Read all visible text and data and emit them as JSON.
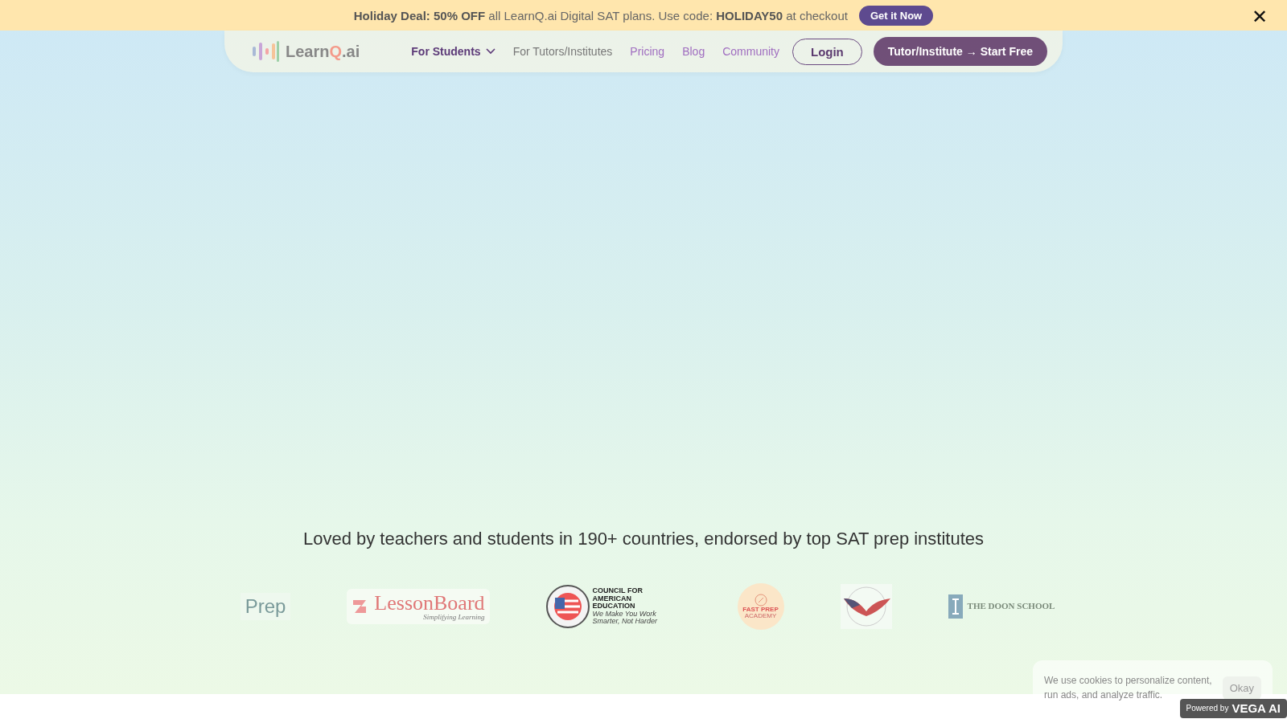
{
  "announcement": {
    "text": "**Holiday Deal: 50% OFF** all LearnQ.ai Digital SAT plans. Use code: **HOLIDAY50** at checkout",
    "button": "Get it Now",
    "close": "✕"
  },
  "navbar": {
    "logo": {
      "first": "Learn",
      "accent": "Q",
      "last": ".ai"
    },
    "items": [
      {
        "label": "For Students",
        "kind": "dropdown",
        "selected": true
      },
      {
        "label": "For Tutors/Institutes",
        "kind": "link",
        "selected": false
      },
      {
        "label": "Pricing",
        "kind": "link",
        "selected": false
      },
      {
        "label": "Blog",
        "kind": "link",
        "selected": false
      },
      {
        "label": "Community",
        "kind": "link",
        "selected": false
      }
    ],
    "login": "Login",
    "cta": "Tutor/Institute → Start Free"
  },
  "tagline": "Loved by teachers and students in 190+ countries, endorsed by top SAT prep institutes",
  "partners": [
    {
      "kind": "prep",
      "name": "Prep"
    },
    {
      "kind": "lessonboard",
      "name": "LessonBoard",
      "sub": "Simplifying Learning"
    },
    {
      "kind": "council",
      "lines": [
        "COUNCIL FOR",
        "AMERICAN",
        "EDUCATION"
      ],
      "sub": "We Make You Work Smarter, Not Harder"
    },
    {
      "kind": "fastprep",
      "name": "FAST PREP",
      "sub": "ACADEMY"
    },
    {
      "kind": "eagle"
    },
    {
      "kind": "doon",
      "name": "THE DOON SCHOOL"
    }
  ],
  "cookie": {
    "text": "We use cookies to personalize content, run ads, and analyze traffic.",
    "button": "Okay",
    "powered": "Powered by",
    "brand": "VEGA AI"
  }
}
